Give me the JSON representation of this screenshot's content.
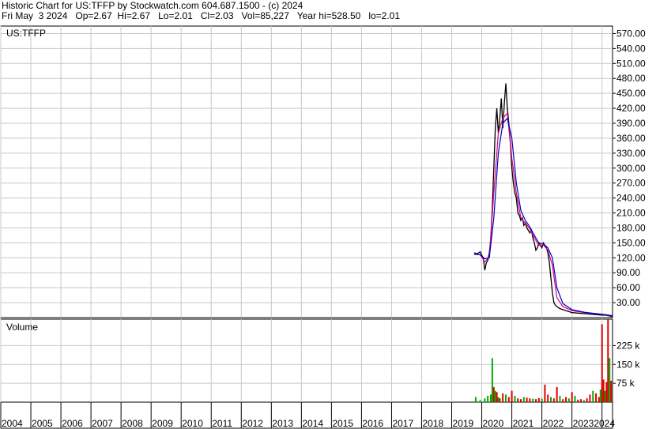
{
  "header": {
    "line1": "Historic Chart for US:TFFP by Stockwatch.com 604.687.1500 - (c) 2024",
    "line2": "Fri May  3 2024   Op=2.67  Hi=2.67   Lo=2.01   Cl=2.03   Vol=85,227   Year hi=528.50   lo=2.01"
  },
  "chart_data": [
    {
      "type": "line",
      "panel": "price",
      "title": "US:TFFP",
      "ylim": [
        0,
        585
      ],
      "yticks": [
        "30.00",
        "60.00",
        "90.00",
        "120.00",
        "150.00",
        "180.00",
        "210.00",
        "240.00",
        "270.00",
        "300.00",
        "330.00",
        "360.00",
        "390.00",
        "420.00",
        "450.00",
        "480.00",
        "510.00",
        "540.00",
        "570.00"
      ],
      "xlim": [
        2004.0,
        2024.35
      ],
      "grid": true,
      "colors": {
        "price": "#000000",
        "ma_short": "#e0007a",
        "ma_long": "#0000cc"
      },
      "series": [
        {
          "x": [
            2019.75,
            2019.85,
            2019.95,
            2020.0,
            2020.05,
            2020.1,
            2020.15,
            2020.2,
            2020.25,
            2020.3,
            2020.35,
            2020.4,
            2020.45,
            2020.5,
            2020.55,
            2020.6,
            2020.65,
            2020.7,
            2020.75,
            2020.8,
            2020.85,
            2020.9,
            2020.95,
            2021.0,
            2021.05,
            2021.1,
            2021.15,
            2021.2,
            2021.25,
            2021.3,
            2021.35,
            2021.4,
            2021.45,
            2021.5,
            2021.55,
            2021.6,
            2021.65,
            2021.7,
            2021.75,
            2021.8,
            2021.85,
            2021.9,
            2021.95,
            2022.0,
            2022.05,
            2022.1,
            2022.15,
            2022.2,
            2022.25,
            2022.3,
            2022.35,
            2022.4,
            2022.45,
            2022.5,
            2022.55,
            2022.6,
            2022.7,
            2022.8,
            2022.9,
            2023.0,
            2023.2,
            2023.4,
            2023.6,
            2023.8,
            2024.0,
            2024.1,
            2024.2,
            2024.34
          ],
          "values": [
            130,
            128,
            132,
            125,
            120,
            95,
            110,
            115,
            130,
            160,
            220,
            300,
            380,
            420,
            370,
            400,
            440,
            380,
            430,
            470,
            420,
            390,
            350,
            300,
            270,
            250,
            240,
            210,
            205,
            195,
            200,
            185,
            190,
            180,
            175,
            170,
            175,
            160,
            150,
            135,
            140,
            150,
            145,
            140,
            150,
            145,
            140,
            130,
            110,
            80,
            50,
            30,
            25,
            22,
            20,
            18,
            16,
            14,
            12,
            10,
            9,
            8,
            7,
            6,
            5,
            5,
            4,
            2.03
          ]
        },
        {
          "x": [
            2019.75,
            2019.95,
            2020.1,
            2020.25,
            2020.4,
            2020.55,
            2020.7,
            2020.85,
            2021.0,
            2021.15,
            2021.3,
            2021.45,
            2021.6,
            2021.75,
            2021.9,
            2022.05,
            2022.2,
            2022.35,
            2022.5,
            2022.7,
            2023.0,
            2023.4,
            2023.8,
            2024.1,
            2024.34
          ],
          "values": [
            128,
            126,
            112,
            122,
            250,
            370,
            400,
            410,
            320,
            250,
            200,
            190,
            178,
            160,
            145,
            146,
            135,
            105,
            40,
            22,
            14,
            10,
            8,
            6,
            3
          ]
        },
        {
          "x": [
            2019.75,
            2019.95,
            2020.1,
            2020.25,
            2020.4,
            2020.55,
            2020.7,
            2020.85,
            2021.0,
            2021.15,
            2021.3,
            2021.45,
            2021.6,
            2021.75,
            2021.9,
            2022.05,
            2022.2,
            2022.35,
            2022.5,
            2022.7,
            2023.0,
            2023.4,
            2023.8,
            2024.1,
            2024.34
          ],
          "values": [
            127,
            126,
            118,
            120,
            200,
            330,
            390,
            400,
            360,
            270,
            215,
            195,
            182,
            165,
            150,
            148,
            140,
            120,
            60,
            28,
            16,
            11,
            8,
            6,
            4
          ]
        }
      ]
    },
    {
      "type": "bar",
      "panel": "volume",
      "title": "Volume",
      "ylim": [
        0,
        330000
      ],
      "yticks": [
        "75 k",
        "150 k",
        "225 k"
      ],
      "xlim": [
        2004.0,
        2024.35
      ],
      "x_axis_labels": [
        "2004",
        "2005",
        "2006",
        "2007",
        "2008",
        "2009",
        "2010",
        "2011",
        "2012",
        "2013",
        "2014",
        "2015",
        "2016",
        "2017",
        "2018",
        "2019",
        "2020",
        "2021",
        "2022",
        "20232024"
      ],
      "colors": {
        "up": "#00aa00",
        "down": "#dd0000"
      },
      "x": [
        2019.8,
        2019.95,
        2020.1,
        2020.2,
        2020.3,
        2020.35,
        2020.4,
        2020.45,
        2020.5,
        2020.55,
        2020.6,
        2020.7,
        2020.8,
        2020.9,
        2021.0,
        2021.1,
        2021.2,
        2021.3,
        2021.4,
        2021.5,
        2021.6,
        2021.7,
        2021.8,
        2021.9,
        2022.0,
        2022.1,
        2022.2,
        2022.3,
        2022.4,
        2022.5,
        2022.6,
        2022.7,
        2022.8,
        2022.9,
        2023.0,
        2023.1,
        2023.2,
        2023.3,
        2023.4,
        2023.5,
        2023.6,
        2023.7,
        2023.8,
        2023.9,
        2023.95,
        2024.0,
        2024.05,
        2024.1,
        2024.15,
        2024.2,
        2024.25,
        2024.3
      ],
      "values": [
        20000,
        8000,
        15000,
        25000,
        30000,
        175000,
        60000,
        45000,
        40000,
        20000,
        15000,
        35000,
        30000,
        20000,
        45000,
        25000,
        15000,
        12000,
        20000,
        18000,
        15000,
        14000,
        12000,
        16000,
        14000,
        70000,
        30000,
        20000,
        15000,
        60000,
        25000,
        12000,
        20000,
        15000,
        40000,
        25000,
        10000,
        12000,
        8000,
        15000,
        30000,
        45000,
        35000,
        20000,
        50000,
        310000,
        90000,
        45000,
        80000,
        330000,
        175000,
        85000
      ],
      "up": [
        true,
        true,
        true,
        true,
        true,
        true,
        false,
        true,
        false,
        true,
        false,
        false,
        true,
        false,
        false,
        true,
        false,
        false,
        true,
        false,
        false,
        true,
        false,
        false,
        true,
        false,
        false,
        true,
        false,
        false,
        true,
        false,
        false,
        true,
        false,
        true,
        false,
        false,
        true,
        false,
        false,
        true,
        false,
        false,
        true,
        false,
        false,
        true,
        false,
        false,
        true,
        false
      ]
    }
  ]
}
